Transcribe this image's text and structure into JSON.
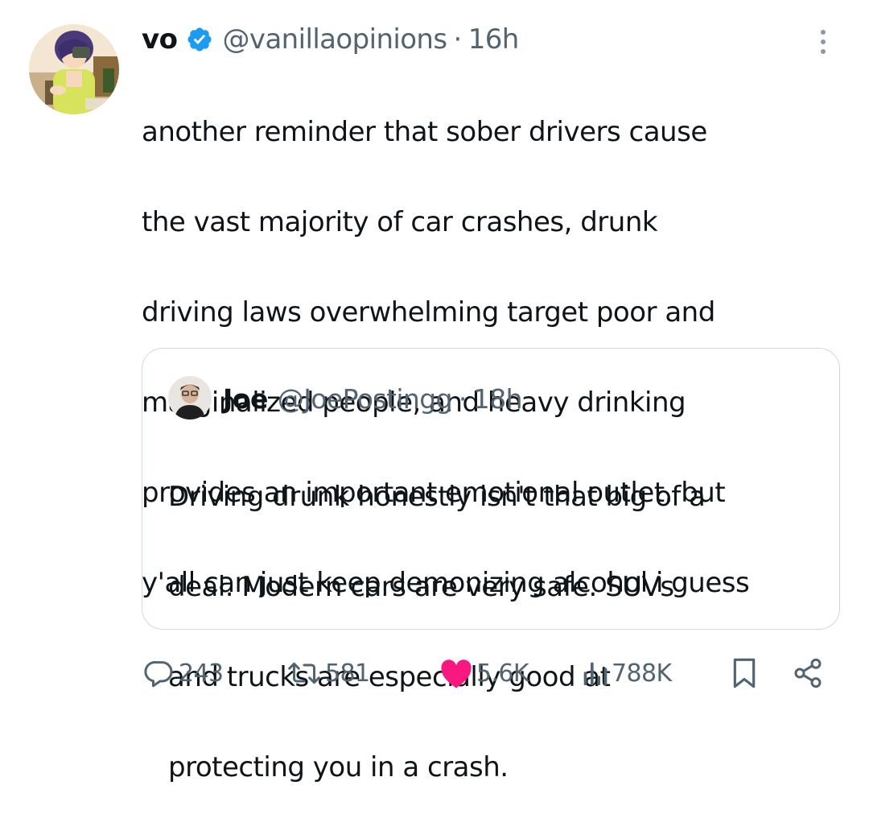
{
  "tweet": {
    "author": {
      "display_name": "vo",
      "verified": true,
      "handle": "@vanillaopinions",
      "time": "16h"
    },
    "separator": "·",
    "text_lines": [
      "another reminder that sober drivers cause",
      "the vast majority of car crashes, drunk",
      "driving laws overwhelming target poor and",
      "marginalized people, and heavy drinking",
      "provides an important emotional outlet. but",
      "y'all can just keep demonizing alcohol i guess"
    ]
  },
  "quote": {
    "author": {
      "display_name": "Joe",
      "handle": "@JoePostingg",
      "time": "18h"
    },
    "separator": "·",
    "text_lines": [
      "Driving drunk honestly isn't that big of a",
      "deal. Modern cars are very safe. SUVs",
      "and trucks are especially good at",
      "protecting you in a crash."
    ]
  },
  "actions": {
    "replies": "243",
    "reposts": "581",
    "likes": "5.6K",
    "views": "788K"
  },
  "icons": {
    "verified": "verified-badge-icon",
    "more": "more-options-icon",
    "reply": "reply-icon",
    "repost": "repost-icon",
    "like": "heart-icon",
    "views": "views-icon",
    "bookmark": "bookmark-icon",
    "share": "share-icon"
  },
  "colors": {
    "text": "#0f1419",
    "secondary": "#536471",
    "verified": "#1d9bf0",
    "like": "#f91880",
    "border": "#cfd9de"
  }
}
